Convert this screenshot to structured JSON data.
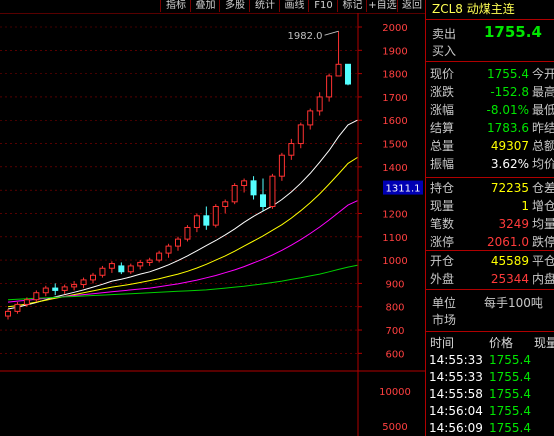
{
  "toolbar": {
    "buttons": [
      "指标",
      "叠加",
      "多股",
      "统计",
      "画线",
      "F10",
      "标记",
      "+自选",
      "返回"
    ]
  },
  "chart": {
    "y_axis": {
      "min": 580,
      "max": 2000,
      "ticks": [
        2000,
        1900,
        1800,
        1700,
        1600,
        1500,
        1400,
        1300,
        1200,
        1100,
        1000,
        900,
        800,
        700,
        600
      ]
    },
    "lower_axis_ticks": [
      "10000",
      "5000"
    ],
    "annotation_high": "1982.0",
    "price_tag": "1311.1",
    "colors": {
      "up": "#ff3232",
      "down": "#54ffff",
      "ma1": "#ffffff",
      "ma2": "#ffff00",
      "ma3": "#ff00ff",
      "ma4": "#00d000"
    }
  },
  "chart_data": {
    "type": "candlestick",
    "candles": [
      {
        "o": 760,
        "h": 790,
        "l": 745,
        "c": 780
      },
      {
        "o": 780,
        "h": 820,
        "l": 770,
        "c": 810
      },
      {
        "o": 810,
        "h": 840,
        "l": 800,
        "c": 830
      },
      {
        "o": 830,
        "h": 870,
        "l": 820,
        "c": 860
      },
      {
        "o": 860,
        "h": 890,
        "l": 845,
        "c": 880
      },
      {
        "o": 880,
        "h": 900,
        "l": 850,
        "c": 870
      },
      {
        "o": 870,
        "h": 895,
        "l": 855,
        "c": 885
      },
      {
        "o": 885,
        "h": 910,
        "l": 870,
        "c": 895
      },
      {
        "o": 895,
        "h": 925,
        "l": 880,
        "c": 915
      },
      {
        "o": 915,
        "h": 945,
        "l": 900,
        "c": 935
      },
      {
        "o": 935,
        "h": 975,
        "l": 925,
        "c": 965
      },
      {
        "o": 965,
        "h": 995,
        "l": 945,
        "c": 985
      },
      {
        "o": 975,
        "h": 990,
        "l": 940,
        "c": 950
      },
      {
        "o": 950,
        "h": 985,
        "l": 940,
        "c": 975
      },
      {
        "o": 975,
        "h": 1000,
        "l": 960,
        "c": 990
      },
      {
        "o": 990,
        "h": 1010,
        "l": 975,
        "c": 1000
      },
      {
        "o": 1000,
        "h": 1040,
        "l": 990,
        "c": 1030
      },
      {
        "o": 1030,
        "h": 1070,
        "l": 1010,
        "c": 1060
      },
      {
        "o": 1060,
        "h": 1100,
        "l": 1040,
        "c": 1090
      },
      {
        "o": 1090,
        "h": 1150,
        "l": 1080,
        "c": 1140
      },
      {
        "o": 1140,
        "h": 1200,
        "l": 1120,
        "c": 1190
      },
      {
        "o": 1190,
        "h": 1230,
        "l": 1130,
        "c": 1150
      },
      {
        "o": 1150,
        "h": 1240,
        "l": 1140,
        "c": 1230
      },
      {
        "o": 1230,
        "h": 1260,
        "l": 1200,
        "c": 1250
      },
      {
        "o": 1250,
        "h": 1330,
        "l": 1240,
        "c": 1320
      },
      {
        "o": 1320,
        "h": 1350,
        "l": 1290,
        "c": 1340
      },
      {
        "o": 1340,
        "h": 1360,
        "l": 1260,
        "c": 1280
      },
      {
        "o": 1280,
        "h": 1350,
        "l": 1210,
        "c": 1230
      },
      {
        "o": 1230,
        "h": 1370,
        "l": 1220,
        "c": 1360
      },
      {
        "o": 1360,
        "h": 1460,
        "l": 1340,
        "c": 1450
      },
      {
        "o": 1450,
        "h": 1520,
        "l": 1430,
        "c": 1500
      },
      {
        "o": 1500,
        "h": 1590,
        "l": 1480,
        "c": 1580
      },
      {
        "o": 1580,
        "h": 1650,
        "l": 1560,
        "c": 1640
      },
      {
        "o": 1640,
        "h": 1720,
        "l": 1620,
        "c": 1700
      },
      {
        "o": 1700,
        "h": 1800,
        "l": 1680,
        "c": 1790
      },
      {
        "o": 1790,
        "h": 1982,
        "l": 1790,
        "c": 1840
      },
      {
        "o": 1840,
        "h": 1835,
        "l": 1750,
        "c": 1755.4
      }
    ],
    "ma_lines": [
      {
        "name": "ma1",
        "values": [
          790,
          798,
          808,
          818,
          830,
          842,
          852,
          862,
          872,
          884,
          896,
          910,
          918,
          928,
          940,
          950,
          964,
          980,
          998,
          1018,
          1040,
          1062,
          1084,
          1108,
          1134,
          1162,
          1188,
          1210,
          1232,
          1260,
          1292,
          1330,
          1372,
          1420,
          1470,
          1530,
          1580,
          1600
        ]
      },
      {
        "name": "ma2",
        "values": [
          800,
          805,
          812,
          820,
          828,
          836,
          844,
          852,
          860,
          868,
          876,
          884,
          890,
          896,
          904,
          912,
          920,
          930,
          940,
          952,
          966,
          982,
          1000,
          1018,
          1038,
          1060,
          1082,
          1104,
          1128,
          1152,
          1180,
          1212,
          1246,
          1284,
          1326,
          1370,
          1415,
          1440
        ]
      },
      {
        "name": "ma3",
        "values": [
          820,
          824,
          828,
          832,
          836,
          840,
          844,
          848,
          852,
          856,
          860,
          864,
          868,
          872,
          876,
          880,
          886,
          892,
          898,
          906,
          914,
          924,
          934,
          946,
          958,
          972,
          988,
          1004,
          1022,
          1042,
          1064,
          1088,
          1114,
          1142,
          1172,
          1204,
          1236,
          1255
        ]
      },
      {
        "name": "ma4",
        "values": [
          830,
          832,
          834,
          836,
          838,
          840,
          842,
          844,
          846,
          848,
          850,
          852,
          854,
          856,
          858,
          860,
          862,
          864,
          866,
          868,
          870,
          872,
          876,
          880,
          884,
          888,
          893,
          898,
          904,
          910,
          917,
          924,
          932,
          940,
          950,
          960,
          970,
          978
        ]
      }
    ]
  },
  "panel": {
    "title": "ZCL8 动煤主连",
    "sell_label": "卖出",
    "sell_price": "1755.4",
    "buy_label": "买入",
    "quote_rows": [
      {
        "label": "现价",
        "value": "1755.4",
        "color": "green",
        "tail": "今开"
      },
      {
        "label": "涨跌",
        "value": "-152.8",
        "color": "green",
        "tail": "最高"
      },
      {
        "label": "涨幅",
        "value": "-8.01%",
        "color": "green",
        "tail": "最低"
      },
      {
        "label": "结算",
        "value": "1783.6",
        "color": "green",
        "tail": "昨结"
      },
      {
        "label": "总量",
        "value": "49307",
        "color": "yellow",
        "tail": "总额"
      },
      {
        "label": "振幅",
        "value": "3.62%",
        "color": "white",
        "tail": "均价"
      }
    ],
    "position_rows": [
      {
        "label": "持仓",
        "value": "72235",
        "color": "yellow",
        "tail": "仓差"
      },
      {
        "label": "现量",
        "value": "1",
        "color": "yellow",
        "tail": "增仓"
      },
      {
        "label": "笔数",
        "value": "3249",
        "color": "red",
        "tail": "均量"
      },
      {
        "label": "涨停",
        "value": "2061.0",
        "color": "red",
        "tail": "跌停"
      }
    ],
    "flow_rows": [
      {
        "label": "开仓",
        "value": "45589",
        "color": "yellow",
        "tail": "平仓"
      },
      {
        "label": "外盘",
        "value": "25344",
        "color": "red",
        "tail": "内盘"
      }
    ],
    "unit_label": "单位",
    "unit_value": "每手100吨",
    "market_label": "市场",
    "ticks_header": {
      "time": "时间",
      "price": "价格",
      "volume": "现量"
    },
    "ticks": [
      {
        "time": "14:55:33",
        "price": "1755.4"
      },
      {
        "time": "14:55:33",
        "price": "1755.4"
      },
      {
        "time": "14:55:58",
        "price": "1755.4"
      },
      {
        "time": "14:56:04",
        "price": "1755.4"
      },
      {
        "time": "14:56:09",
        "price": "1755.4"
      }
    ]
  }
}
